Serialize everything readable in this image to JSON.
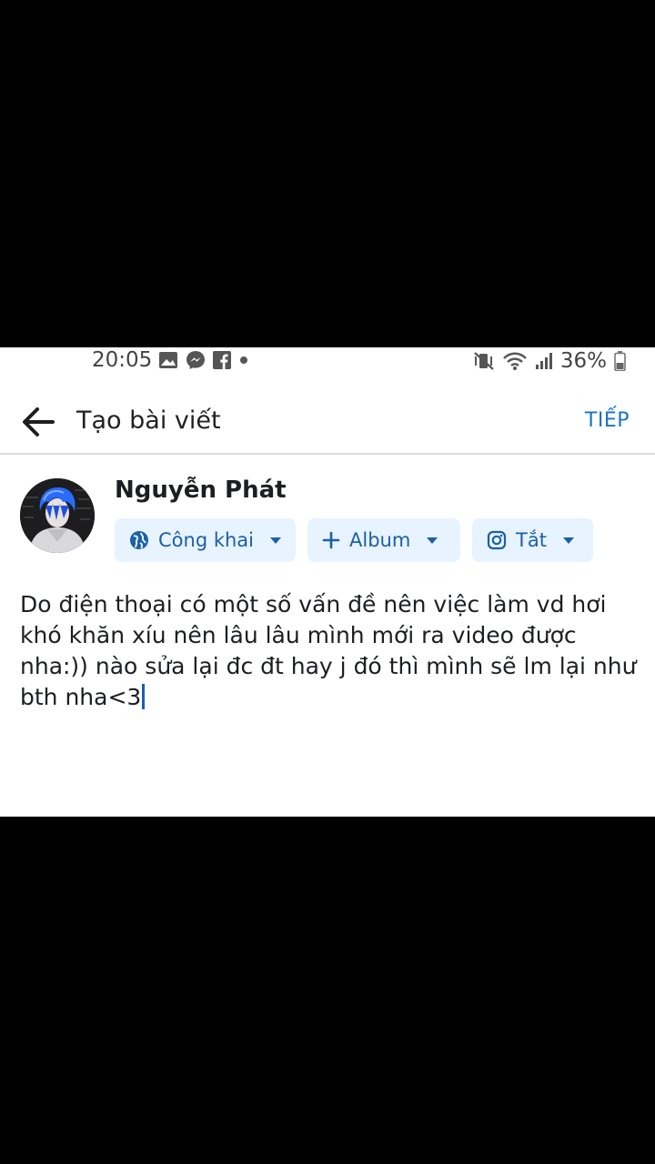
{
  "status_bar": {
    "time": "20:05",
    "left_icons": [
      "gallery-icon",
      "messenger-icon",
      "facebook-icon",
      "dot-icon"
    ],
    "right_icons": [
      "mute-vibrate-icon",
      "wifi-icon",
      "signal-icon",
      "battery-icon"
    ],
    "battery": "36%"
  },
  "header": {
    "title": "Tạo bài viết",
    "next_label": "TIẾP",
    "accent": "#1a73c8"
  },
  "user": {
    "name": "Nguyễn Phát",
    "avatar_icon": "avatar-image"
  },
  "chips": {
    "privacy": {
      "icon": "globe-icon",
      "label": "Công khai"
    },
    "album": {
      "icon": "plus-icon",
      "label": "Album"
    },
    "instagram": {
      "icon": "instagram-icon",
      "label": "Tắt"
    }
  },
  "post": {
    "text": "Do điện thoại có một số vấn đề nên việc làm vd hơi khó khăn xíu nên lâu lâu mình mới ra video được nha:)) nào sửa lại đc đt hay j đó thì mình sẽ lm lại như bth nha<3"
  },
  "colors": {
    "chip_bg": "#e7f3ff",
    "chip_text": "#1b5fa8"
  }
}
